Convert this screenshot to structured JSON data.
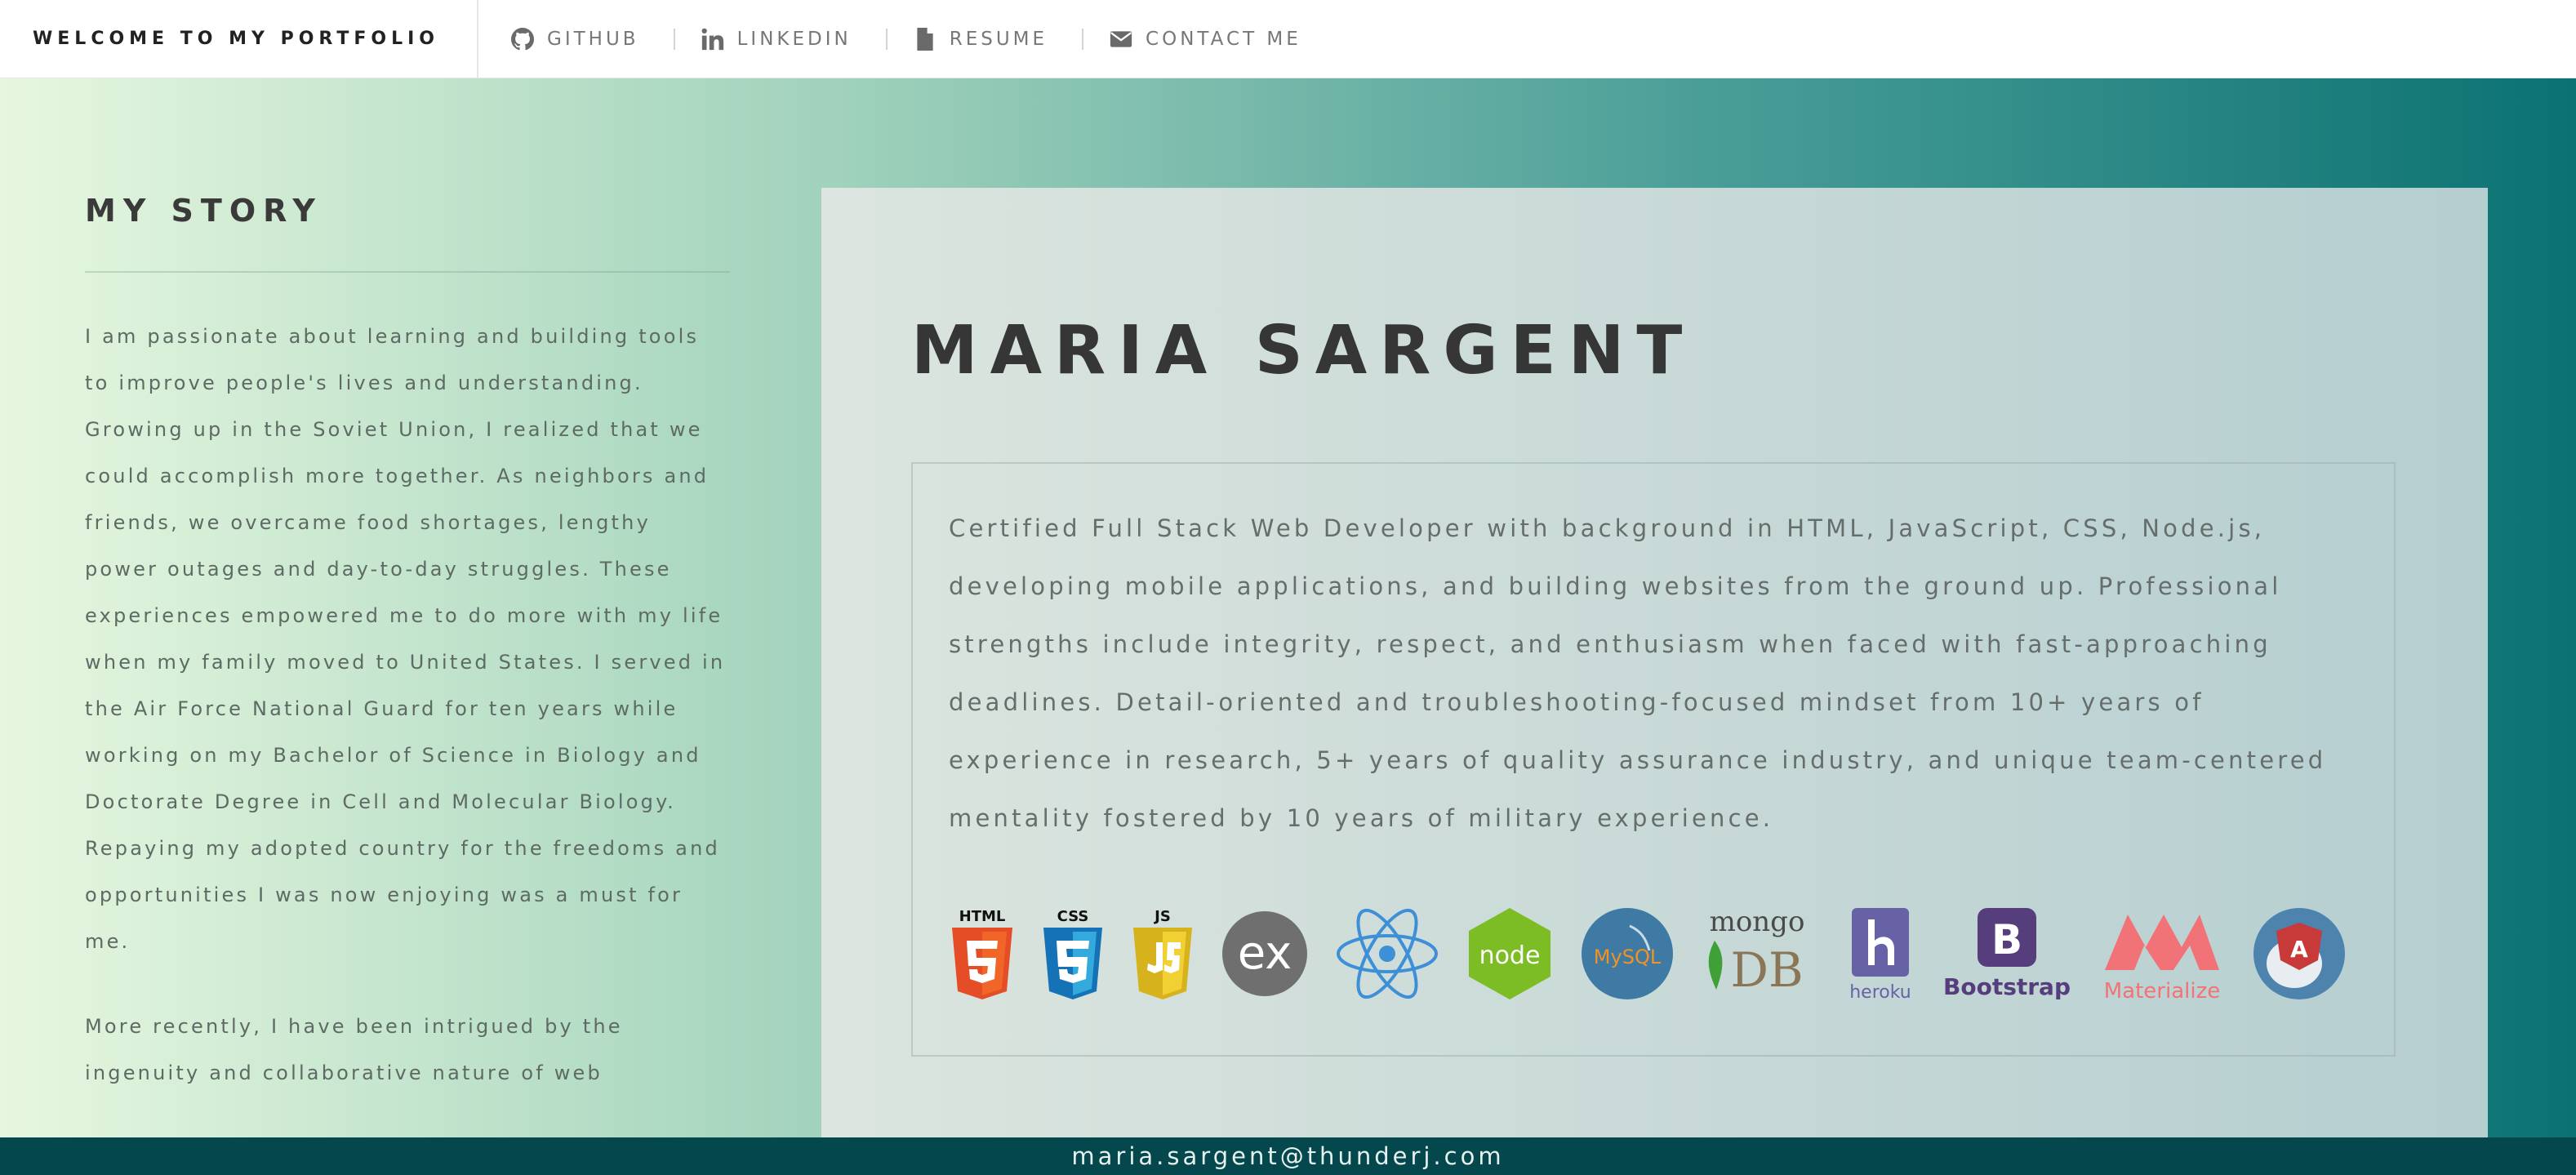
{
  "navbar": {
    "brand": "WELCOME TO MY PORTFOLIO",
    "links": [
      {
        "label": "GITHUB",
        "icon": "github-icon"
      },
      {
        "label": "LINKEDIN",
        "icon": "linkedin-icon"
      },
      {
        "label": "RESUME",
        "icon": "file-icon"
      },
      {
        "label": "CONTACT ME",
        "icon": "envelope-icon"
      }
    ]
  },
  "story": {
    "title": "MY STORY",
    "paragraphs": [
      "I am passionate about learning and building tools to improve people's lives and understanding. Growing up in the Soviet Union, I realized that we could accomplish more together. As neighbors and friends, we overcame food shortages, lengthy power outages and day-to-day struggles. These experiences empowered me to do more with my life when my family moved to United States. I served in the Air Force National Guard for ten years while working on my Bachelor of Science in Biology and Doctorate Degree in Cell and Molecular Biology. Repaying my adopted country for the freedoms and opportunities I was now enjoying was a must for me.",
      "More recently, I have been intrigued by the ingenuity and collaborative nature of web"
    ]
  },
  "profile": {
    "name": "MARIA SARGENT",
    "summary": "Certified Full Stack Web Developer with background in HTML, JavaScript, CSS, Node.js, developing mobile applications, and building websites from the ground up. Professional strengths include integrity, respect, and enthusiasm when faced with fast-approaching deadlines. Detail-oriented and troubleshooting-focused mindset from 10+ years of experience in research, 5+ years of quality assurance industry, and unique team-centered mentality fostered by 10 years of military experience.",
    "tech_logos": [
      {
        "icon": "html5-icon",
        "label": "HTML"
      },
      {
        "icon": "css3-icon",
        "label": "CSS"
      },
      {
        "icon": "js-icon",
        "label": "JS"
      },
      {
        "icon": "express-icon",
        "label": "ex"
      },
      {
        "icon": "react-icon",
        "label": ""
      },
      {
        "icon": "node-icon",
        "label": "node"
      },
      {
        "icon": "mysql-icon",
        "label": "MySQL"
      },
      {
        "icon": "mongodb-icon",
        "label_top": "mongo",
        "label_bottom": "DB"
      },
      {
        "icon": "heroku-icon",
        "label": "heroku"
      },
      {
        "icon": "bootstrap-icon",
        "label": "Bootstrap"
      },
      {
        "icon": "materialize-icon",
        "label": "Materialize"
      },
      {
        "icon": "angular-icon",
        "label": "A"
      }
    ]
  },
  "footer": {
    "email": "maria.sargent@thunderj.com"
  },
  "colors": {
    "accent_dark": "#04474c",
    "gradient_start": "#e7f7df",
    "gradient_end": "#0b7272",
    "heading": "#363636",
    "body_text": "#666e6c"
  }
}
